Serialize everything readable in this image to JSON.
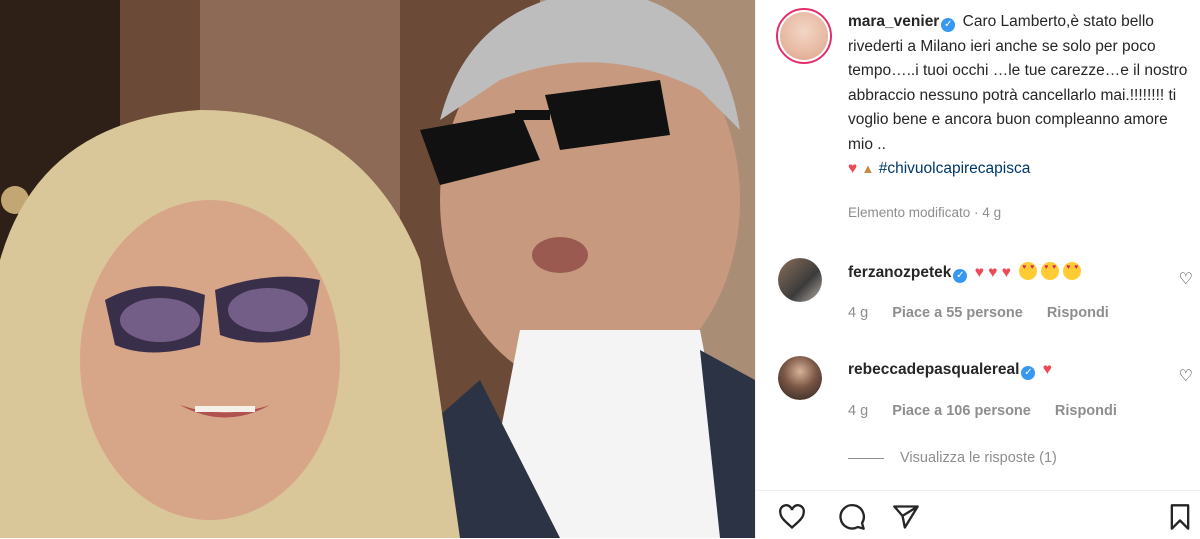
{
  "post": {
    "author": "mara_venier",
    "caption": "Caro Lamberto,è stato bello rivederti a Milano ieri anche se solo per poco tempo…..i tuoi occhi …le tue carezze…e il nostro abbraccio nessuno potrà cancellarlo mai.!!!!!!!! ti voglio bene e ancora buon compleanno amore mio ..",
    "hashtag": "#chivuolcapirecapisca",
    "edited_label": "Elemento modificato · 4 g"
  },
  "comments": [
    {
      "username": "ferzanozpetek",
      "age": "4 g",
      "likes": "Piace a 55 persone",
      "reply": "Rispondi"
    },
    {
      "username": "rebeccadepasqualereal",
      "age": "4 g",
      "likes": "Piace a 106 persone",
      "reply": "Rispondi"
    }
  ],
  "view_replies": "Visualizza le risposte (1)",
  "icons": {
    "like": "heart-icon",
    "comment": "comment-icon",
    "share": "share-icon",
    "save": "bookmark-icon",
    "verified": "verified-badge-icon"
  },
  "colors": {
    "verified": "#3897f0",
    "heart": "#ed4956",
    "hashtag": "#00376b",
    "muted": "#8e8e8e"
  }
}
